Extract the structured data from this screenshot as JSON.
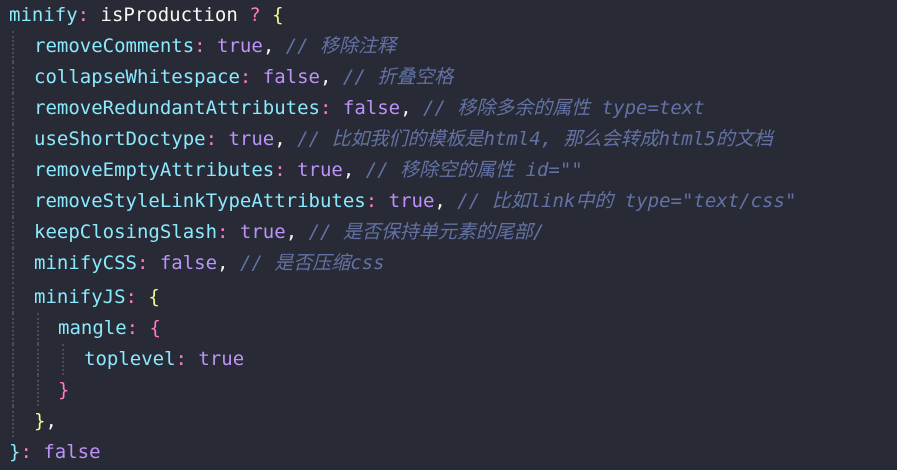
{
  "colors": {
    "background": "#282a36",
    "key": "#8be9fd",
    "boolean": "#bd93f9",
    "comment": "#6272a4",
    "operator": "#ff79c6",
    "brace_level1": "#f1fa8c",
    "brace_level2": "#ff79c6"
  },
  "lines": [
    {
      "key": "minify",
      "colon": ":",
      "rest": " isProduction ",
      "op": "?",
      "open": " {"
    },
    {
      "key": "removeComments",
      "colon": ":",
      "value": " true",
      "comma": ",",
      "comment": " // 移除注释"
    },
    {
      "key": "collapseWhitespace",
      "colon": ":",
      "value": " false",
      "comma": ",",
      "comment": " // 折叠空格"
    },
    {
      "key": "removeRedundantAttributes",
      "colon": ":",
      "value": " false",
      "comma": ",",
      "comment": " // 移除多余的属性 type=text"
    },
    {
      "key": "useShortDoctype",
      "colon": ":",
      "value": " true",
      "comma": ",",
      "comment": " // 比如我们的模板是html4, 那么会转成html5的文档"
    },
    {
      "key": "removeEmptyAttributes",
      "colon": ":",
      "value": " true",
      "comma": ",",
      "comment": " // 移除空的属性 id=\"\""
    },
    {
      "key": "removeStyleLinkTypeAttributes",
      "colon": ":",
      "value": " true",
      "comma": ",",
      "comment": " // 比如link中的 type=\"text/css\""
    },
    {
      "key": "keepClosingSlash",
      "colon": ":",
      "value": " true",
      "comma": ",",
      "comment": " // 是否保持单元素的尾部/"
    },
    {
      "key": "minifyCSS",
      "colon": ":",
      "value": " false",
      "comma": ",",
      "comment": " // 是否压缩css"
    },
    {
      "key": "minifyJS",
      "colon": ":",
      "open": " {"
    },
    {
      "key": "mangle",
      "colon": ":",
      "open": " {"
    },
    {
      "key": "toplevel",
      "colon": ":",
      "value": " true"
    },
    {
      "close": "}"
    },
    {
      "close": "}",
      "comma": ","
    },
    {
      "close": "}",
      "colon": ":",
      "value": " false"
    }
  ]
}
